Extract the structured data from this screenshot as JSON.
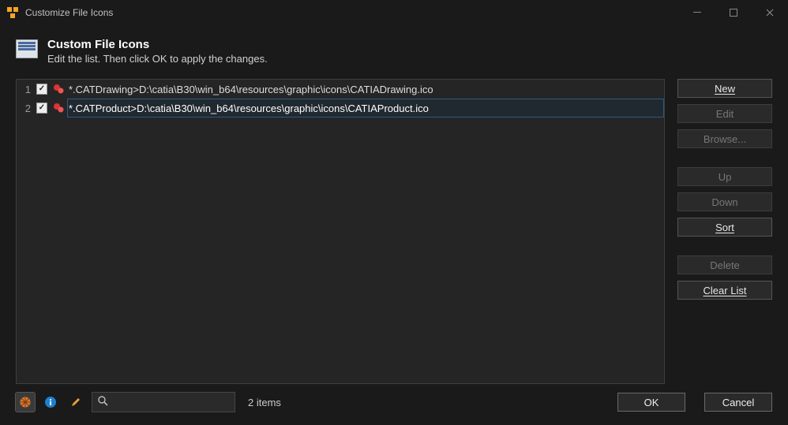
{
  "window": {
    "title": "Customize File Icons"
  },
  "banner": {
    "heading": "Custom File Icons",
    "subtitle": "Edit the list. Then click OK to apply the changes."
  },
  "rows": [
    {
      "num": "1",
      "checked": true,
      "text": "*.CATDrawing>D:\\catia\\B30\\win_b64\\resources\\graphic\\icons\\CATIADrawing.ico",
      "selected": false
    },
    {
      "num": "2",
      "checked": true,
      "text": "*.CATProduct>D:\\catia\\B30\\win_b64\\resources\\graphic\\icons\\CATIAProduct.ico",
      "selected": true
    }
  ],
  "buttons": {
    "new": "New",
    "edit": "Edit",
    "browse": "Browse...",
    "up": "Up",
    "down": "Down",
    "sort": "Sort",
    "delete": "Delete",
    "clear": "Clear List"
  },
  "footer": {
    "count": "2 items",
    "ok": "OK",
    "cancel": "Cancel",
    "search_placeholder": ""
  }
}
